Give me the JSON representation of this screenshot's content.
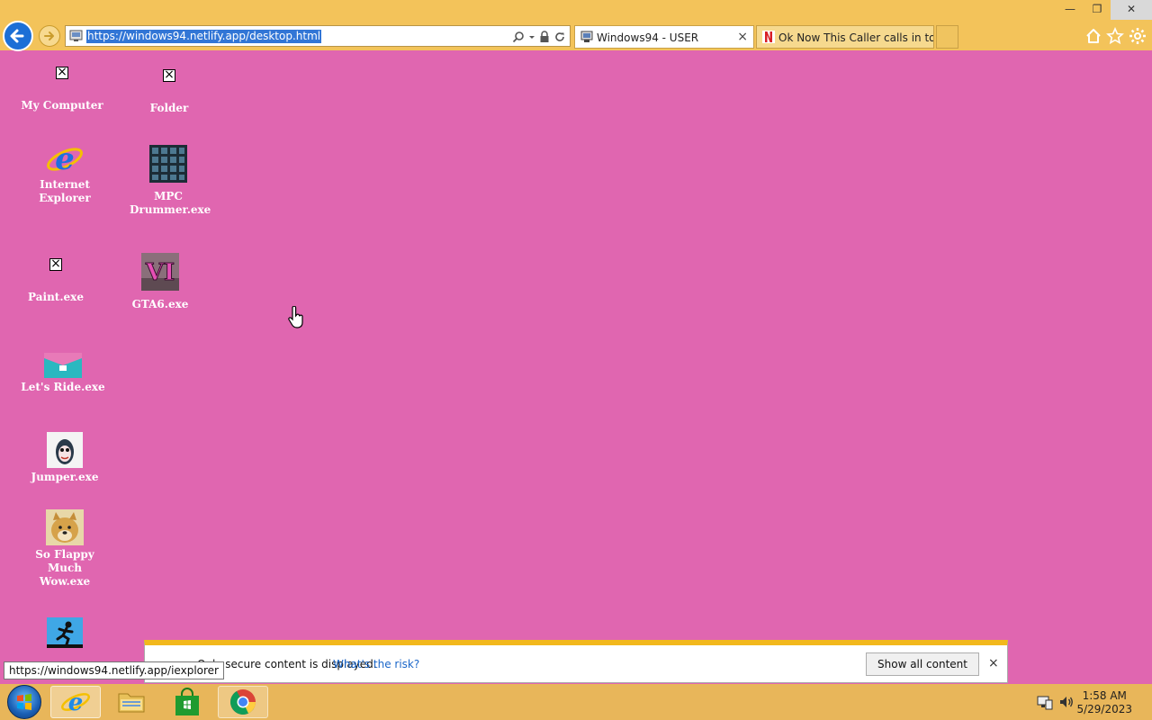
{
  "browser": {
    "address": "https://windows94.netlify.app/desktop.html",
    "tabs": [
      {
        "label": "Windows94 - USER",
        "close": "×"
      },
      {
        "label": "Ok Now This Caller calls in to f..."
      }
    ],
    "window_buttons": {
      "minimize": "—",
      "restore": "❐",
      "close": "✕"
    }
  },
  "desktop": {
    "icons": [
      {
        "label": "My Computer"
      },
      {
        "label": "Folder"
      },
      {
        "label": "Internet Explorer"
      },
      {
        "label": "MPC Drummer.exe"
      },
      {
        "label": "Paint.exe"
      },
      {
        "label": "GTA6.exe",
        "image_text": "VI"
      },
      {
        "label": "Let's Ride.exe"
      },
      {
        "label": "Jumper.exe"
      },
      {
        "label": "So Flappy Much Wow.exe"
      }
    ]
  },
  "notification": {
    "message": "Only secure content is displayed.",
    "link": "What's the risk?",
    "button": "Show all content",
    "close": "×"
  },
  "status_tooltip": "https://windows94.netlify.app/iexplorer",
  "taskbar": {
    "time": "1:58 AM",
    "date": "5/29/2023"
  },
  "colors": {
    "desktop_bg": "#e066b0",
    "chrome_bg": "#f3c35a",
    "taskbar_bg": "#e8b65a",
    "notification_accent": "#f2b81c"
  }
}
